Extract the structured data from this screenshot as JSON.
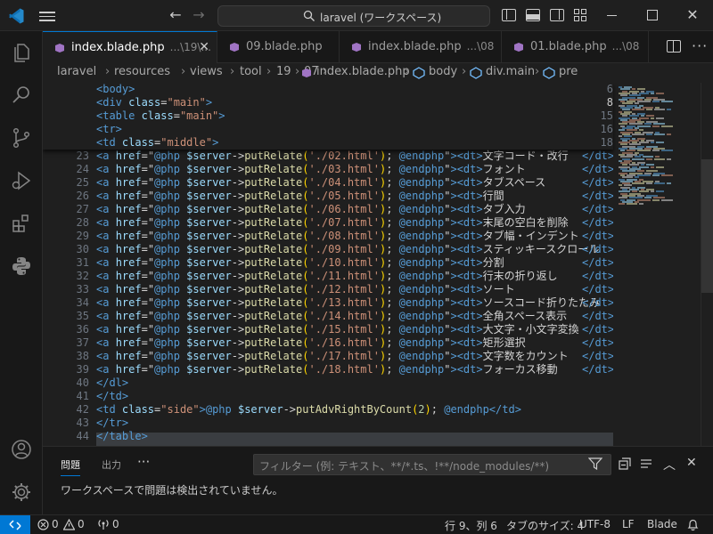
{
  "titlebar": {
    "search_text": "laravel (ワークスペース)"
  },
  "tabs": [
    {
      "name": "index.blade.php",
      "desc": "...\\19\\..."
    },
    {
      "name": "09.blade.php",
      "desc": ""
    },
    {
      "name": "index.blade.php",
      "desc": "...\\08"
    },
    {
      "name": "01.blade.php",
      "desc": "...\\08"
    }
  ],
  "breadcrumb": [
    "laravel",
    "resources",
    "views",
    "tool",
    "19",
    "07",
    "index.blade.php",
    "body",
    "div.main",
    "pre"
  ],
  "sticky_lines": [
    {
      "n": "6",
      "code": [
        [
          "t-tag",
          "<body>"
        ]
      ]
    },
    {
      "n": "8",
      "code": [
        [
          "t-tag",
          "<div "
        ],
        [
          "t-attr",
          "class"
        ],
        [
          "t-op",
          "="
        ],
        [
          "t-str",
          "\"main\""
        ],
        [
          "t-tag",
          ">"
        ]
      ]
    },
    {
      "n": "15",
      "code": [
        [
          "t-tag",
          "<table "
        ],
        [
          "t-attr",
          "class"
        ],
        [
          "t-op",
          "="
        ],
        [
          "t-str",
          "\"main\""
        ],
        [
          "t-tag",
          ">"
        ]
      ]
    },
    {
      "n": "16",
      "code": [
        [
          "t-tag",
          "<tr>"
        ]
      ]
    },
    {
      "n": "18",
      "code": [
        [
          "t-tag",
          "<td "
        ],
        [
          "t-attr",
          "class"
        ],
        [
          "t-op",
          "="
        ],
        [
          "t-str",
          "\"middle\""
        ],
        [
          "t-tag",
          ">"
        ]
      ]
    }
  ],
  "dt_lines": [
    {
      "n": "23",
      "page": "'./02.html'",
      "label": "文字コード・改行"
    },
    {
      "n": "24",
      "page": "'./03.html'",
      "label": "フォント"
    },
    {
      "n": "25",
      "page": "'./04.html'",
      "label": "タブスペース"
    },
    {
      "n": "26",
      "page": "'./05.html'",
      "label": "行間"
    },
    {
      "n": "27",
      "page": "'./06.html'",
      "label": "タブ入力"
    },
    {
      "n": "28",
      "page": "'./07.html'",
      "label": "末尾の空白を削除"
    },
    {
      "n": "29",
      "page": "'./08.html'",
      "label": "タブ幅・インデント"
    },
    {
      "n": "30",
      "page": "'./09.html'",
      "label": "スティッキースクロール"
    },
    {
      "n": "31",
      "page": "'./10.html'",
      "label": "分割"
    },
    {
      "n": "32",
      "page": "'./11.html'",
      "label": "行末の折り返し"
    },
    {
      "n": "33",
      "page": "'./12.html'",
      "label": "ソート"
    },
    {
      "n": "34",
      "page": "'./13.html'",
      "label": "ソースコード折りたたみ"
    },
    {
      "n": "35",
      "page": "'./14.html'",
      "label": "全角スペース表示"
    },
    {
      "n": "36",
      "page": "'./15.html'",
      "label": "大文字・小文字変換"
    },
    {
      "n": "37",
      "page": "'./16.html'",
      "label": "矩形選択"
    },
    {
      "n": "38",
      "page": "'./17.html'",
      "label": "文字数をカウント"
    },
    {
      "n": "39",
      "page": "'./18.html'",
      "label": "フォーカス移動"
    }
  ],
  "dt_parts": {
    "open": "<a ",
    "href": "href",
    "php_open": "@php ",
    "var": "$server",
    "arrow": "->",
    "fn": "putRelate",
    "php_close": "@endphp",
    "dt_open": "<dt>",
    "dt_close": "</dt>"
  },
  "tail_lines": [
    {
      "n": "40",
      "code": [
        [
          "t-tag",
          "</dl>"
        ]
      ]
    },
    {
      "n": "41",
      "code": [
        [
          "t-tag",
          "</td>"
        ]
      ]
    },
    {
      "n": "42",
      "code": [
        [
          "t-tag",
          "<td "
        ],
        [
          "t-attr",
          "class"
        ],
        [
          "t-op",
          "="
        ],
        [
          "t-str",
          "\"side\""
        ],
        [
          "t-tag",
          ">"
        ],
        [
          "t-php",
          "@php "
        ],
        [
          "t-var",
          "$server"
        ],
        [
          "t-op",
          "->"
        ],
        [
          "t-fn",
          "putAdvRightByCount"
        ],
        [
          "t-yellow",
          "("
        ],
        [
          "t-num",
          "2"
        ],
        [
          "t-yellow",
          ")"
        ],
        [
          "t-op",
          "; "
        ],
        [
          "t-php",
          "@endphp"
        ],
        [
          "t-tag",
          "</td>"
        ]
      ]
    },
    {
      "n": "43",
      "code": [
        [
          "t-tag",
          "</tr>"
        ]
      ]
    },
    {
      "n": "44",
      "code": [
        [
          "t-tag",
          "</table>"
        ]
      ]
    }
  ],
  "panel": {
    "tab_problems": "問題",
    "tab_output": "出力",
    "filter_placeholder": "フィルター (例: テキスト、**/*.ts、!**/node_modules/**)",
    "message": "ワークスペースで問題は検出されていません。"
  },
  "status": {
    "errors": "0",
    "warnings": "0",
    "ports": "0",
    "position": "行 9、列 6",
    "tabsize": "タブのサイズ: 4",
    "encoding": "UTF-8",
    "eol": "LF",
    "language": "Blade"
  },
  "colors": {
    "accent": "#0078d4",
    "background": "#1f1f1f"
  }
}
